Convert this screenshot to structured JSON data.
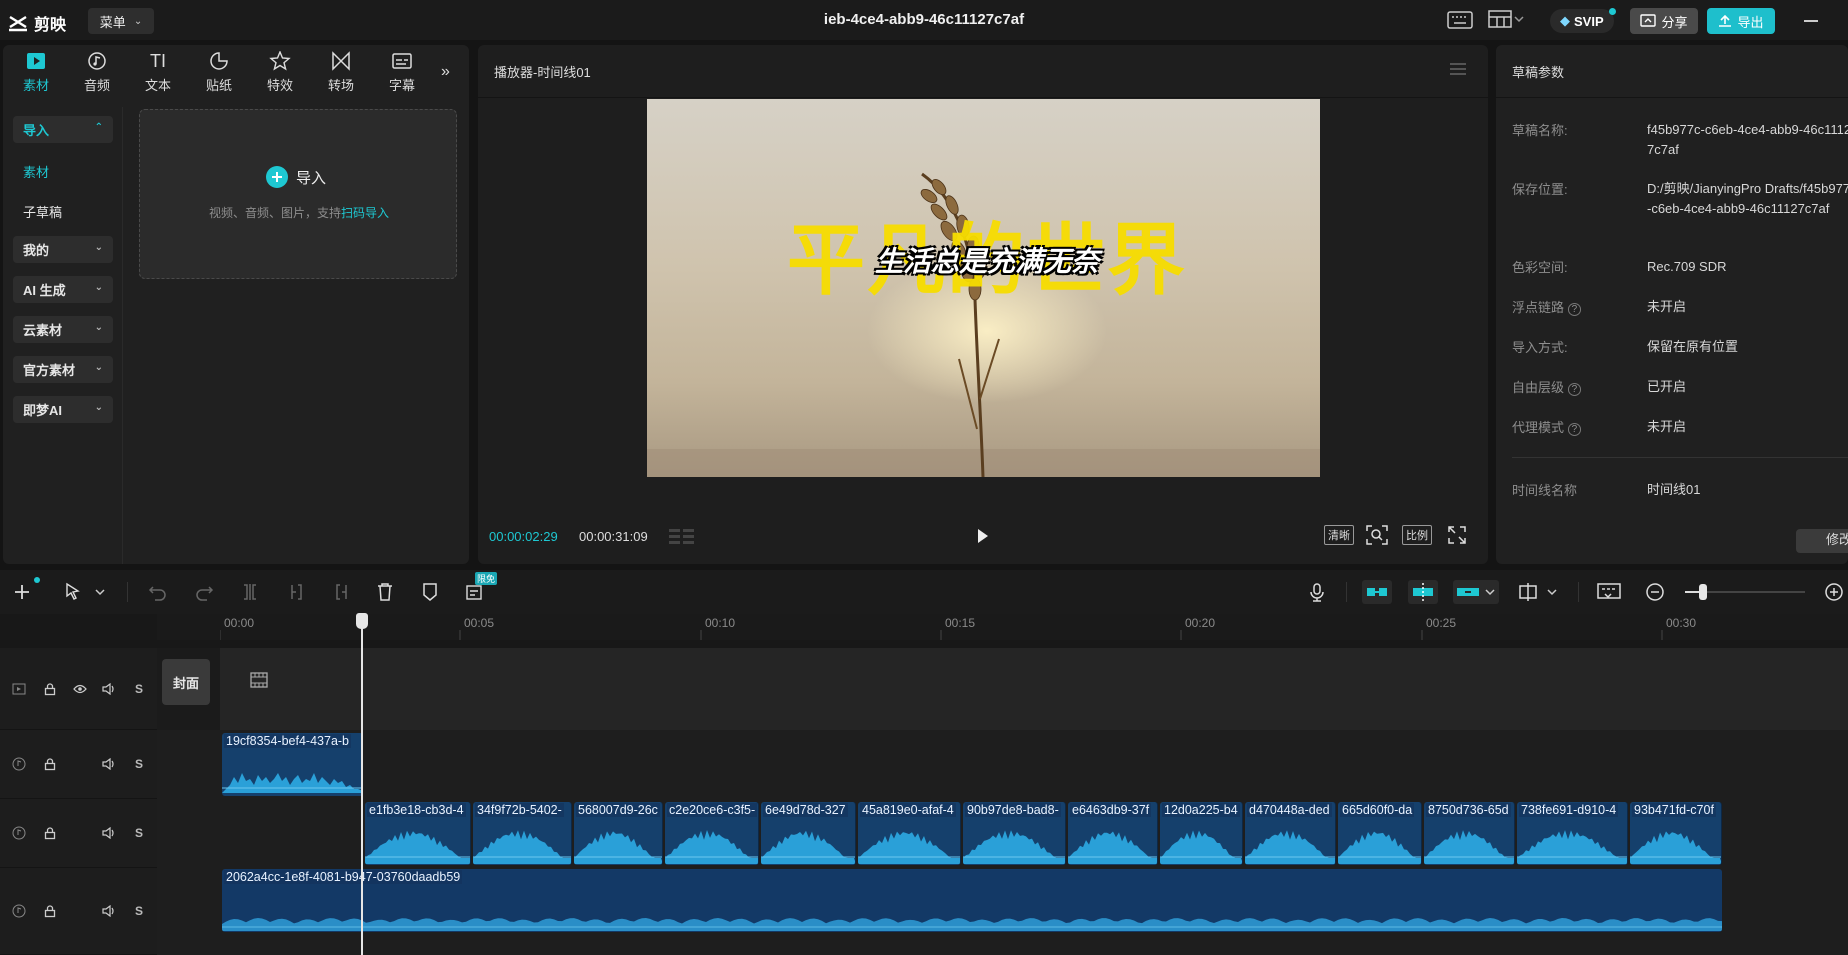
{
  "app": {
    "logo_text": "剪映",
    "menu_label": "菜单",
    "document_title": "ieb-4ce4-abb9-46c11127c7af",
    "svip_label": "SVIP",
    "share_label": "分享",
    "export_label": "导出",
    "accent_color": "#1ec8d2"
  },
  "toolbar_tabs": [
    {
      "label": "素材",
      "icon": "media-icon"
    },
    {
      "label": "音频",
      "icon": "audio-icon"
    },
    {
      "label": "文本",
      "icon": "text-icon"
    },
    {
      "label": "贴纸",
      "icon": "sticker-icon"
    },
    {
      "label": "特效",
      "icon": "effects-icon"
    },
    {
      "label": "转场",
      "icon": "transition-icon"
    },
    {
      "label": "字幕",
      "icon": "subtitle-icon"
    }
  ],
  "sidebar": {
    "items": [
      {
        "label": "导入"
      },
      {
        "label": "素材"
      },
      {
        "label": "子草稿"
      },
      {
        "label": "我的"
      },
      {
        "label": "AI 生成"
      },
      {
        "label": "云素材"
      },
      {
        "label": "官方素材"
      },
      {
        "label": "即梦AI"
      }
    ]
  },
  "import_area": {
    "button_label": "导入",
    "hint_text": "视频、音频、图片，支持",
    "hint_link": "扫码导入"
  },
  "player": {
    "title": "播放器-时间线01",
    "current_time": "00:00:02:29",
    "total_time": "00:00:31:09",
    "overlay_text_yellow": "平凡的世界",
    "overlay_text_white": "生活总是充满无奈",
    "clarity_label": "清晰",
    "ratio_label": "比例"
  },
  "draft_params": {
    "header": "草稿参数",
    "rows": [
      {
        "label": "草稿名称:",
        "value": "f45b977c-c6eb-4ce4-abb9-46c11127c7af"
      },
      {
        "label": "保存位置:",
        "value": "D:/剪映/JianyingPro Drafts/f45b977c-c6eb-4ce4-abb9-46c11127c7af"
      },
      {
        "label": "色彩空间:",
        "value": "Rec.709 SDR"
      },
      {
        "label": "浮点链路",
        "value": "未开启"
      },
      {
        "label": "导入方式:",
        "value": "保留在原有位置"
      },
      {
        "label": "自由层级",
        "value": "已开启"
      },
      {
        "label": "代理模式",
        "value": "未开启"
      },
      {
        "label": "时间线名称",
        "value": "时间线01"
      }
    ],
    "modify_label": "修改"
  },
  "timeline": {
    "limited_badge": "限免",
    "ruler_labels": [
      "00:00",
      "00:05",
      "00:10",
      "00:15",
      "00:20",
      "00:25",
      "00:30"
    ],
    "cover_label": "封面",
    "tracks": {
      "audio1_clip": "19cf8354-bef4-437a-b",
      "audio2_clips": [
        "e1fb3e18-cb3d-4",
        "34f9f72b-5402-",
        "568007d9-26c",
        "c2e20ce6-c3f5-",
        "6e49d78d-327",
        "45a819e0-afaf-4",
        "90b97de8-bad8-",
        "e6463db9-37f",
        "12d0a225-b4",
        "d470448a-ded",
        "665d60f0-da",
        "8750d736-65d",
        "738fe691-d910-4",
        "93b471fd-c70f"
      ],
      "audio3_clip": "2062a4cc-1e8f-4081-b947-03760daadb59"
    },
    "track_s_label": "S"
  }
}
